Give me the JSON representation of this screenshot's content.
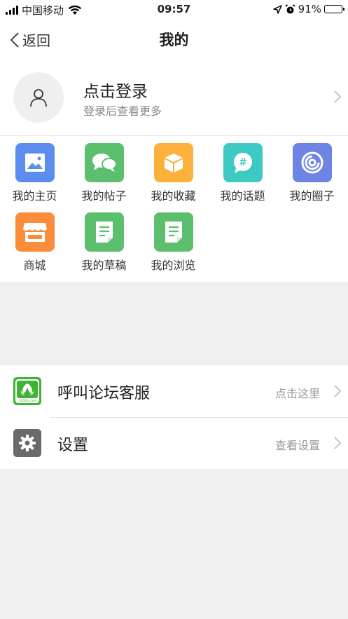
{
  "status_bar": {
    "carrier": "中国移动",
    "time": "09:57",
    "battery": "91%",
    "battery_level": 0.91
  },
  "nav": {
    "back_label": "返回",
    "title": "我的"
  },
  "profile": {
    "title": "点击登录",
    "subtitle": "登录后查看更多"
  },
  "grid": {
    "items": [
      {
        "label": "我的主页",
        "icon": "image-icon",
        "color": "#5b8def"
      },
      {
        "label": "我的帖子",
        "icon": "chat-bubbles-icon",
        "color": "#5cbf6e"
      },
      {
        "label": "我的收藏",
        "icon": "box-icon",
        "color": "#fbb13c"
      },
      {
        "label": "我的话题",
        "icon": "hashtag-icon",
        "color": "#3ec9c3"
      },
      {
        "label": "我的圈子",
        "icon": "spiral-icon",
        "color": "#6e84e5"
      },
      {
        "label": "商城",
        "icon": "store-icon",
        "color": "#fb8c3a"
      },
      {
        "label": "我的草稿",
        "icon": "document-icon",
        "color": "#5cbf6e"
      },
      {
        "label": "我的浏览",
        "icon": "document-icon",
        "color": "#5cbf6e"
      }
    ]
  },
  "list": {
    "items": [
      {
        "label": "呼叫论坛客服",
        "hint": "点击这里",
        "icon": "forum-logo-icon",
        "logo_text": "21000.com"
      },
      {
        "label": "设置",
        "hint": "查看设置",
        "icon": "gear-icon"
      }
    ]
  }
}
